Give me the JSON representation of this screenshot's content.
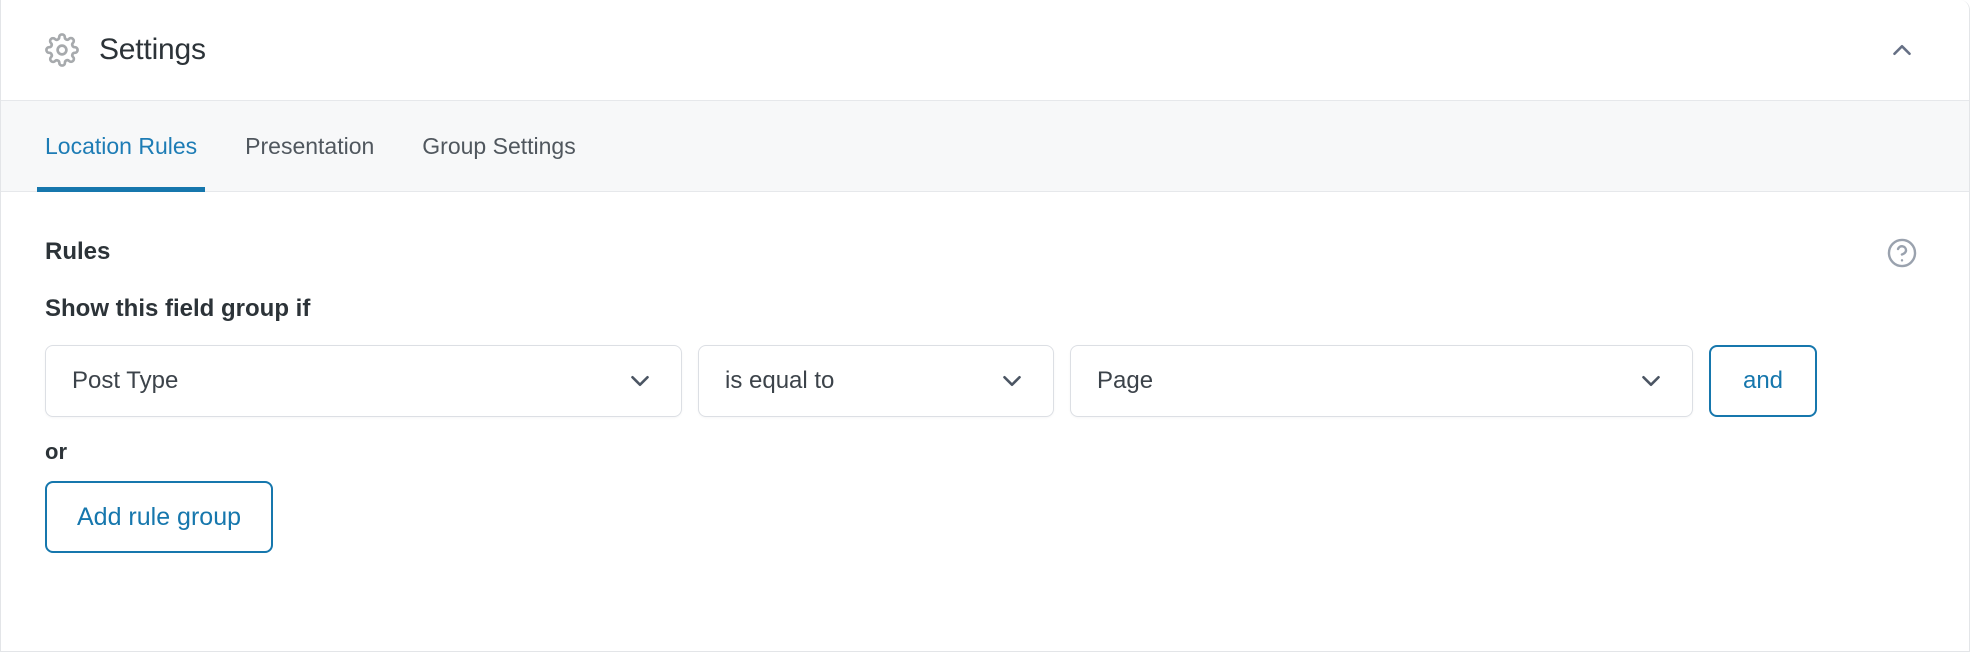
{
  "header": {
    "icon": "gear-icon",
    "title": "Settings",
    "collapse_icon": "chevron-up-icon"
  },
  "tabs": [
    {
      "label": "Location Rules",
      "active": true
    },
    {
      "label": "Presentation",
      "active": false
    },
    {
      "label": "Group Settings",
      "active": false
    }
  ],
  "rules": {
    "heading": "Rules",
    "help_icon": "question-circle-icon",
    "subheading": "Show this field group if",
    "row": {
      "param": {
        "value": "Post Type",
        "chevron_icon": "chevron-down-icon"
      },
      "operator": {
        "value": "is equal to",
        "chevron_icon": "chevron-down-icon"
      },
      "field_value": {
        "value": "Page",
        "chevron_icon": "chevron-down-icon"
      },
      "and_label": "and"
    },
    "or_label": "or",
    "add_rule_group_label": "Add rule group"
  },
  "colors": {
    "accent_blue": "#1677ad",
    "tab_active": "#1d7cb5",
    "text_dark": "#2c3338",
    "text_muted": "#50575e",
    "border": "#dcdfe4",
    "tabbar_bg": "#f7f8f9"
  }
}
